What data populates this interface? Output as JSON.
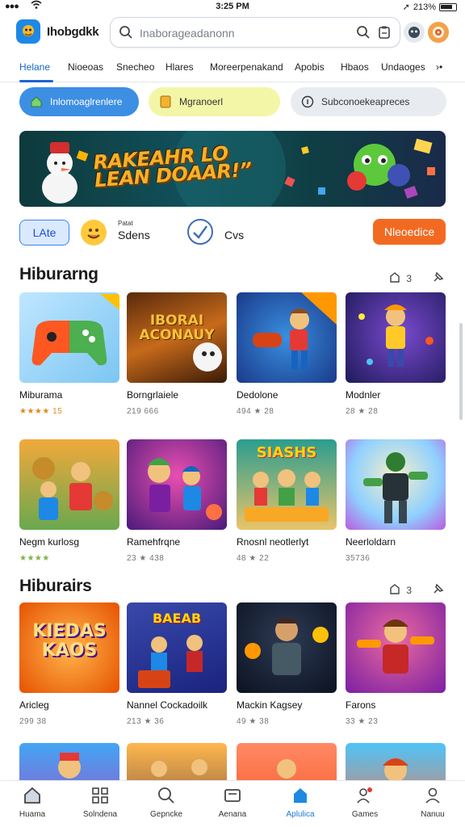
{
  "status": {
    "time": "3:25 PM",
    "battery": "213%"
  },
  "header": {
    "app_name": "Ihobgdkk",
    "search_placeholder": "Inaborageadanonn"
  },
  "tabs": [
    "Helane",
    "Nioeoas",
    "Snecheo",
    "Hlares",
    "Moreerpenakand",
    "Apobis",
    "Hbaos",
    "Undaoges",
    "›•"
  ],
  "chips": [
    {
      "label": "Inlomoaglrenlere",
      "bg": "#3d8fe3",
      "fg": "#ffffff"
    },
    {
      "label": "Mgranoerl",
      "bg": "#f3f6a6",
      "fg": "#333333"
    },
    {
      "label": "Subconoekeapreces",
      "bg": "#e8ecf1",
      "fg": "#333333"
    }
  ],
  "banner": {
    "title": "RAKEAHR LO LEAN DOAAR!”"
  },
  "row2": {
    "late_label": "LAte",
    "small_label": "Patat",
    "big_label": "Sdens",
    "cvs_label": "Cvs",
    "orange_label": "Nleoedice"
  },
  "section1": {
    "title": "Hiburarng",
    "count": "3"
  },
  "section2": {
    "title": "Hiburairs",
    "count": "3"
  },
  "cards_row1": [
    {
      "title": "Miburama",
      "meta": "★★★★ 15"
    },
    {
      "title": "Borngrlaiele",
      "meta": "219 666"
    },
    {
      "title": "Dedolone",
      "meta": "494 ★ 28"
    },
    {
      "title": "Modnler",
      "meta": "28 ★ 28"
    }
  ],
  "cards_row2": [
    {
      "title": "Negm kurlosg",
      "meta": "★★★★"
    },
    {
      "title": "Ramehfrqne",
      "meta": "23 ★ 438"
    },
    {
      "title": "Rnosnl neotlerlyt",
      "meta": "48 ★ 22"
    },
    {
      "title": "Neerloldarn",
      "meta": "35736"
    }
  ],
  "cards_row3": [
    {
      "title": "Aricleg",
      "meta": "299 38"
    },
    {
      "title": "Nannel Cockadoilk",
      "meta": "213 ★ 36"
    },
    {
      "title": "Mackin Kagsey",
      "meta": "49 ★ 38"
    },
    {
      "title": "Farons",
      "meta": "33 ★ 23"
    }
  ],
  "thumb_texts": {
    "r1c2": "IBORAI ACONAUY",
    "r2c3": "SIASHS",
    "r3c1": "KIEDAS KAOS",
    "r3c2": "BAEAB"
  },
  "bottom_nav": [
    {
      "label": "Huama",
      "icon": "home-icon"
    },
    {
      "label": "Solndena",
      "icon": "apps-icon"
    },
    {
      "label": "Gepncke",
      "icon": "search-icon"
    },
    {
      "label": "Aenana",
      "icon": "card-icon"
    },
    {
      "label": "Aplulica",
      "icon": "app-store-icon"
    },
    {
      "label": "Games",
      "icon": "people-icon"
    },
    {
      "label": "Nanuu",
      "icon": "person-icon"
    }
  ],
  "colors": {
    "accent": "#1e63d6",
    "orange": "#f26a21"
  }
}
